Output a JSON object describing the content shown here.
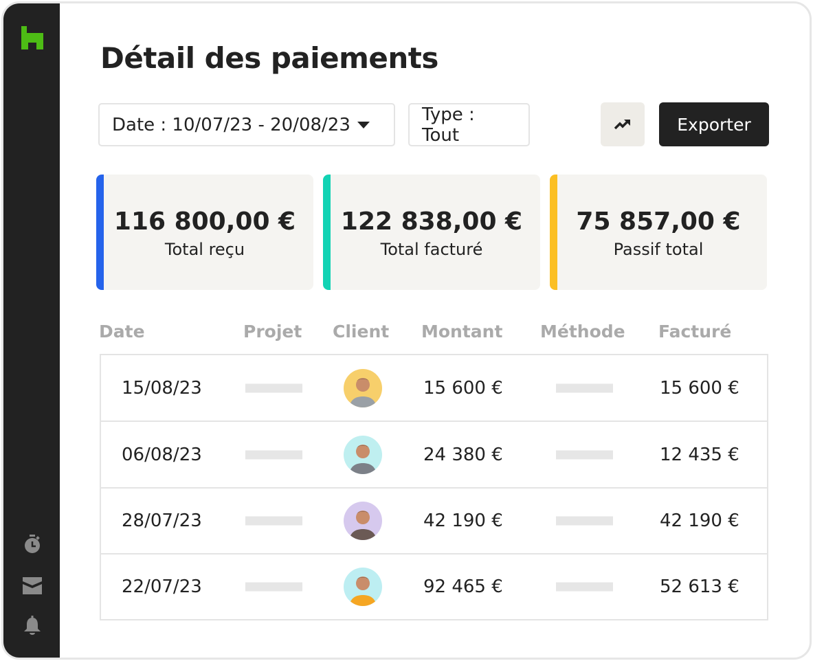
{
  "title": "Détail des paiements",
  "filters": {
    "date": "Date : 10/07/23 - 20/08/23",
    "type": "Type : Tout"
  },
  "toolbar": {
    "export_label": "Exporter"
  },
  "summary": [
    {
      "amount": "116 800,00 €",
      "label": "Total reçu",
      "color": "#2563eb"
    },
    {
      "amount": "122 838,00 €",
      "label": "Total facturé",
      "color": "#12d3b4"
    },
    {
      "amount": "75 857,00 €",
      "label": "Passif total",
      "color": "#fbbf24"
    }
  ],
  "table": {
    "headers": [
      "Date",
      "Projet",
      "Client",
      "Montant",
      "Méthode",
      "Facturé"
    ],
    "rows": [
      {
        "date": "15/08/23",
        "amount": "15 600 €",
        "billed": "15 600 €",
        "avatar_bg": "#f7cf6b",
        "shirt": "#9aa0a6"
      },
      {
        "date": "06/08/23",
        "amount": "24 380 €",
        "billed": "12 435 €",
        "avatar_bg": "#bfeff0",
        "shirt": "#7c8088"
      },
      {
        "date": "28/07/23",
        "amount": "42 190 €",
        "billed": "42 190 €",
        "avatar_bg": "#d6c9ee",
        "shirt": "#6b5a55"
      },
      {
        "date": "22/07/23",
        "amount": "92 465 €",
        "billed": "52 613 €",
        "avatar_bg": "#bdeef2",
        "shirt": "#f5a623"
      }
    ]
  }
}
